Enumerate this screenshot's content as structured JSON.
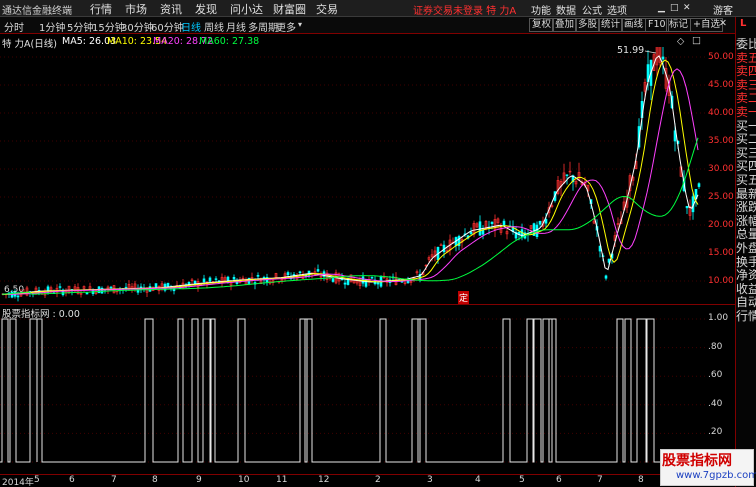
{
  "app": {
    "title": "通达信金融终端"
  },
  "menu": [
    "行情",
    "市场",
    "资讯",
    "发现",
    "问小达",
    "财富圈",
    "交易"
  ],
  "notice": "证券交易未登录  特 力A",
  "right_menu": [
    "功能",
    "数据",
    "公式",
    "选项"
  ],
  "user": "游客",
  "periods": [
    "分时",
    "1分钟",
    "5分钟",
    "15分钟",
    "30分钟",
    "60分钟",
    "日线",
    "周线",
    "月线",
    "多周期",
    "更多"
  ],
  "active_period": "日线",
  "toolbar_buttons": [
    "复权",
    "叠加",
    "多股",
    "统计",
    "画线",
    "F10",
    "标记",
    "+自选"
  ],
  "stock": {
    "name": "特 力A",
    "period": "(日线)"
  },
  "ma": [
    {
      "label": "MA5: 26.03",
      "color": "#ffffff"
    },
    {
      "label": "MA10: 23.54",
      "color": "#ffff00"
    },
    {
      "label": "MA20: 28.72",
      "color": "#ff40ff"
    },
    {
      "label": "MA60: 27.38",
      "color": "#00ff40"
    }
  ],
  "price_marks": {
    "high": "51.99",
    "low": "6.50"
  },
  "ding_label": "定",
  "indicator": {
    "label": "股票指标网 : 0.00"
  },
  "price_axis": [
    "50.00",
    "45.00",
    "40.00",
    "35.00",
    "30.00",
    "25.00",
    "20.00",
    "15.00",
    "10.00"
  ],
  "indicator_axis": [
    "1.00",
    ".80",
    ".60",
    ".40",
    ".20",
    ".00"
  ],
  "x_axis": [
    "2014年",
    "5",
    "6",
    "7",
    "8",
    "9",
    "10",
    "11",
    "12",
    "2",
    "3",
    "4",
    "5",
    "6",
    "7",
    "8"
  ],
  "sidebar_items": [
    "委比",
    "卖五",
    "卖四",
    "卖三",
    "卖二",
    "卖一",
    "买一",
    "买二",
    "买三",
    "买四",
    "买五",
    "最新",
    "涨跌",
    "涨幅",
    "总量",
    "外盘",
    "换手",
    "净资",
    "收益",
    "自动",
    "行情"
  ],
  "sidebar_marker": "L",
  "watermark": {
    "title": "股票指标网",
    "url": "www.7gpzb.com"
  },
  "colors": {
    "up": "#ff3030",
    "down": "#00ffff",
    "accent": "#800000"
  }
}
